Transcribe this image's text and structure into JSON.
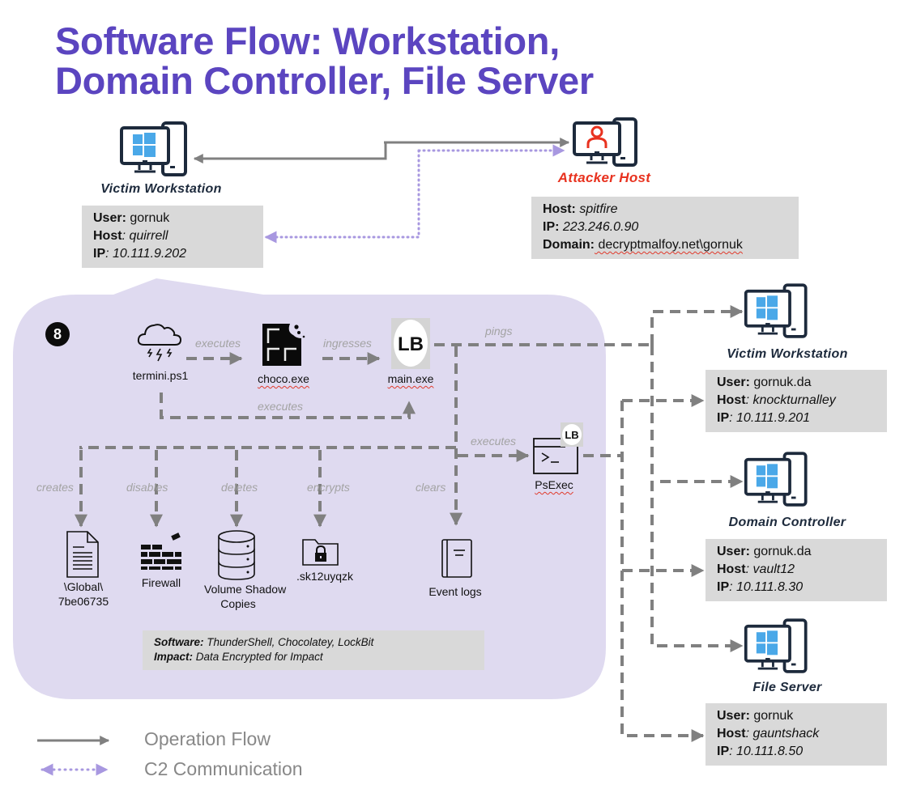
{
  "title": {
    "line1": "Software Flow: Workstation,",
    "line2": "Domain Controller, File Server"
  },
  "colors": {
    "title": "#5B45C0",
    "attacker": "#e8321f",
    "host_label": "#1d2a3c",
    "panel_bg": "#dfdaf0",
    "info_bg": "#d9d9d9",
    "flow_line": "#808080",
    "c2_line": "#a898e0",
    "windows_blue": "#4aa8e8"
  },
  "hosts": {
    "victim_top": {
      "icon": "windows-workstation-icon",
      "label": "Victim Workstation",
      "fields": [
        {
          "key": "User:",
          "value": " gornuk",
          "italic": false
        },
        {
          "key": "Host",
          "value": ": quirrell",
          "italic": true
        },
        {
          "key": "IP",
          "value": ": 10.111.9.202",
          "italic": true
        }
      ]
    },
    "attacker": {
      "icon": "attacker-workstation-icon",
      "label": "Attacker Host",
      "fields": [
        {
          "key": "Host:",
          "value": " spitfire",
          "italic": true
        },
        {
          "key": "IP:",
          "value": " 223.246.0.90",
          "italic": true
        },
        {
          "key": "Domain:",
          "value": " decryptmalfoy.net\\gornuk",
          "italic": false
        }
      ]
    },
    "victim_right": {
      "icon": "windows-workstation-icon",
      "label": "Victim Workstation",
      "fields": [
        {
          "key": "User:",
          "value": " gornuk.da",
          "italic": false
        },
        {
          "key": "Host",
          "value": ": knockturnalley",
          "italic": true
        },
        {
          "key": "IP",
          "value": ": 10.111.9.201",
          "italic": true
        }
      ]
    },
    "domain_controller": {
      "icon": "windows-workstation-icon",
      "label": "Domain Controller",
      "fields": [
        {
          "key": "User:",
          "value": " gornuk.da",
          "italic": false
        },
        {
          "key": "Host",
          "value": ": vault12",
          "italic": true
        },
        {
          "key": "IP",
          "value": ": 10.111.8.30",
          "italic": true
        }
      ]
    },
    "file_server": {
      "icon": "windows-workstation-icon",
      "label": "File Server",
      "fields": [
        {
          "key": "User:",
          "value": " gornuk",
          "italic": false
        },
        {
          "key": "Host",
          "value": ": gauntshack",
          "italic": true
        },
        {
          "key": "IP",
          "value": ": 10.111.8.50",
          "italic": true
        }
      ]
    }
  },
  "step": {
    "number": "8",
    "nodes": {
      "termini": {
        "label": "termini.ps1",
        "icon": "thundershell-cloud-icon"
      },
      "choco": {
        "label": "choco.exe",
        "icon": "chocolatey-icon"
      },
      "main": {
        "label": "main.exe",
        "icon": "lockbit-icon"
      },
      "psexec": {
        "label": "PsExec",
        "icon": "terminal-icon"
      },
      "global": {
        "label1": "\\Global\\",
        "label2": "7be06735",
        "icon": "document-icon"
      },
      "firewall": {
        "label": "Firewall",
        "icon": "firewall-icon"
      },
      "vss": {
        "label1": "Volume Shadow",
        "label2": "Copies",
        "icon": "database-icon"
      },
      "encrypted": {
        "label": ".sk12uyqzk",
        "icon": "locked-folder-icon"
      },
      "eventlogs": {
        "label": "Event logs",
        "icon": "log-book-icon"
      }
    },
    "edges": {
      "termini_choco": "executes",
      "choco_main": "ingresses",
      "termini_main": "executes",
      "main_pings": "pings",
      "main_psexec": "executes",
      "creates": "creates",
      "disables": "disables",
      "deletes": "deletes",
      "encrypts": "encrypts",
      "clears": "clears"
    },
    "summary": {
      "software_key": "Software:",
      "software_value": " ThunderShell, Chocolatey, LockBit",
      "impact_key": "Impact:",
      "impact_value": " Data Encrypted for Impact"
    }
  },
  "legend": {
    "operation_flow": "Operation Flow",
    "c2": "C2 Communication"
  }
}
